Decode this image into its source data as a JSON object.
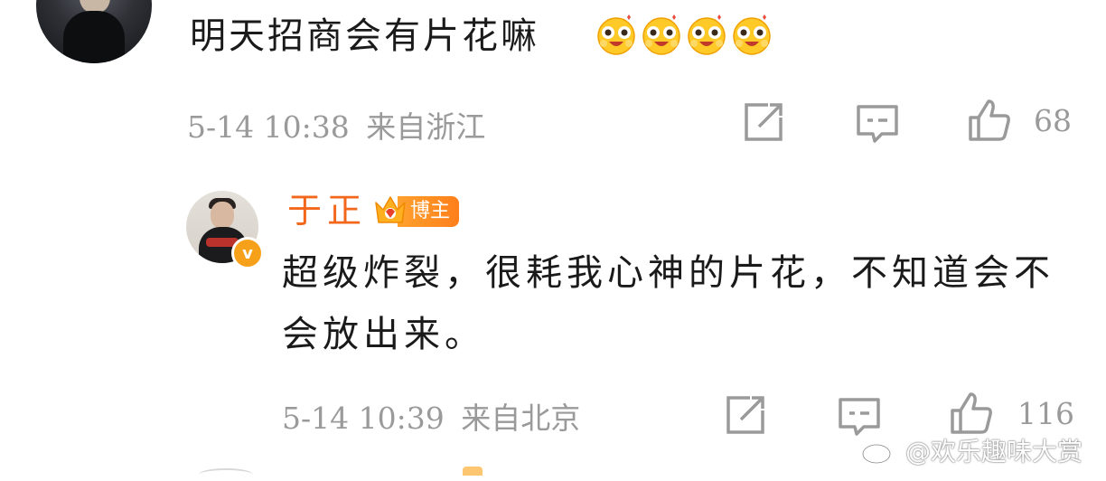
{
  "comment": {
    "text": "明天招商会有片花嘛",
    "emojis": [
      "laughing-emoji",
      "laughing-emoji",
      "laughing-emoji",
      "laughing-emoji"
    ],
    "timestamp": "5-14 10:38",
    "location": "来自浙江",
    "like_count": "68"
  },
  "reply": {
    "author": "于正",
    "badge": "博主",
    "verified_mark": "v",
    "text": "超级炸裂，很耗我心神的片花，不知道会不会放出来。",
    "timestamp": "5-14 10:39",
    "location": "来自北京",
    "like_count": "116"
  },
  "watermark": {
    "text": "@欢乐趣味大赏"
  },
  "colors": {
    "author_name": "#f2671b",
    "meta_gray": "#9a9a9a",
    "badge_orange": "#ff8c1f",
    "verified_orange": "#f7a11a"
  },
  "icons": [
    "share-icon",
    "comment-icon",
    "like-icon",
    "crown-icon",
    "weibo-logo-icon"
  ]
}
